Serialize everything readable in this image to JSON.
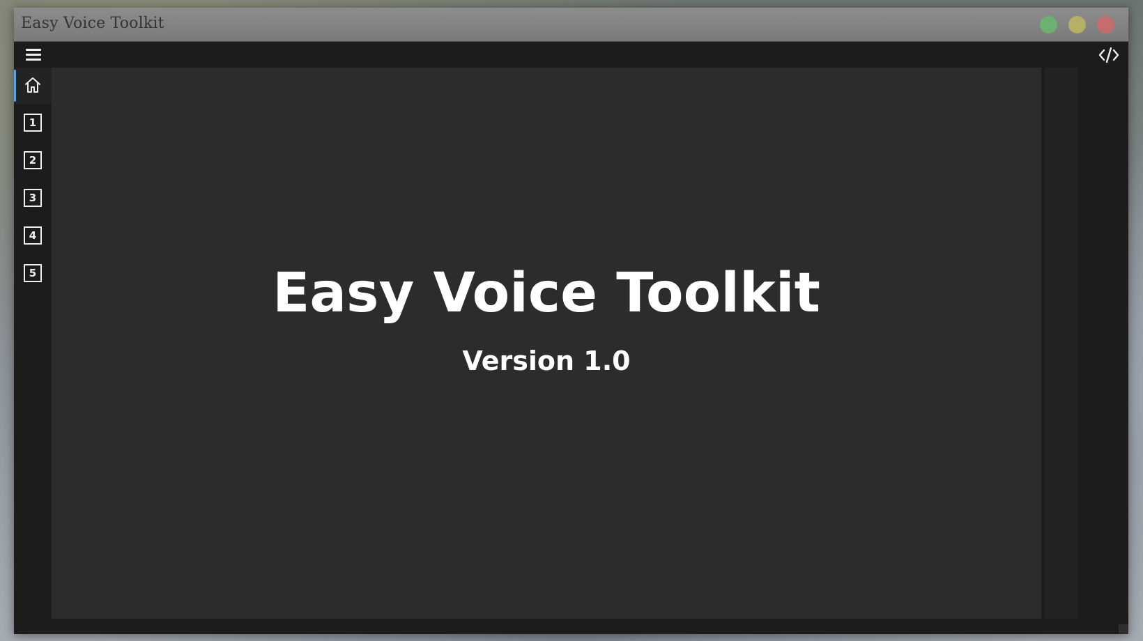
{
  "window": {
    "title": "Easy Voice Toolkit"
  },
  "titlebar_buttons": {
    "maximize_color": "#6cb170",
    "minimize_color": "#b5b065",
    "close_color": "#c46d6d"
  },
  "toolbar": {
    "menu_icon": "hamburger-menu-icon",
    "code_icon": "code-icon"
  },
  "sidebar": {
    "accent_color": "#5ea3e0",
    "items": [
      {
        "icon": "home-icon",
        "label": ""
      },
      {
        "icon": "number-box-icon",
        "label": "1"
      },
      {
        "icon": "number-box-icon",
        "label": "2"
      },
      {
        "icon": "number-box-icon",
        "label": "3"
      },
      {
        "icon": "number-box-icon",
        "label": "4"
      },
      {
        "icon": "number-box-icon",
        "label": "5"
      }
    ]
  },
  "main": {
    "title": "Easy Voice Toolkit",
    "version": "Version 1.0"
  }
}
